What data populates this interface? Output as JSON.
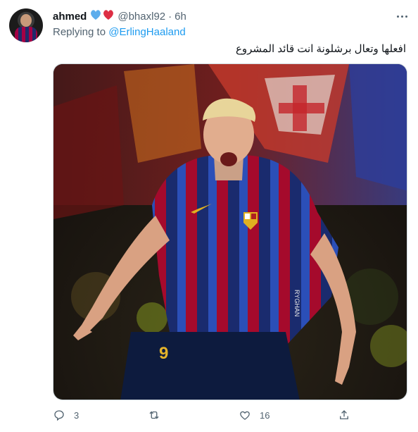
{
  "tweet": {
    "author_name": "ahmed",
    "emoji": "💙❤",
    "handle": "@bhaxl92",
    "separator": "·",
    "time": "6h",
    "replying_prefix": "Replying to",
    "replying_to": "@ErlingHaaland",
    "text": "افعلها وتعال برشلونة انت قائد المشروع",
    "image": {
      "jersey_number": "9",
      "sponsor_text": "RYGHAN"
    },
    "actions": {
      "reply_count": "3",
      "retweet_count": "",
      "like_count": "16"
    }
  },
  "colors": {
    "link": "#1d9bf0",
    "secondary_text": "#536471",
    "border": "#cfd9de",
    "barca_blue": "#1f3d8f",
    "barca_red": "#a50044"
  }
}
